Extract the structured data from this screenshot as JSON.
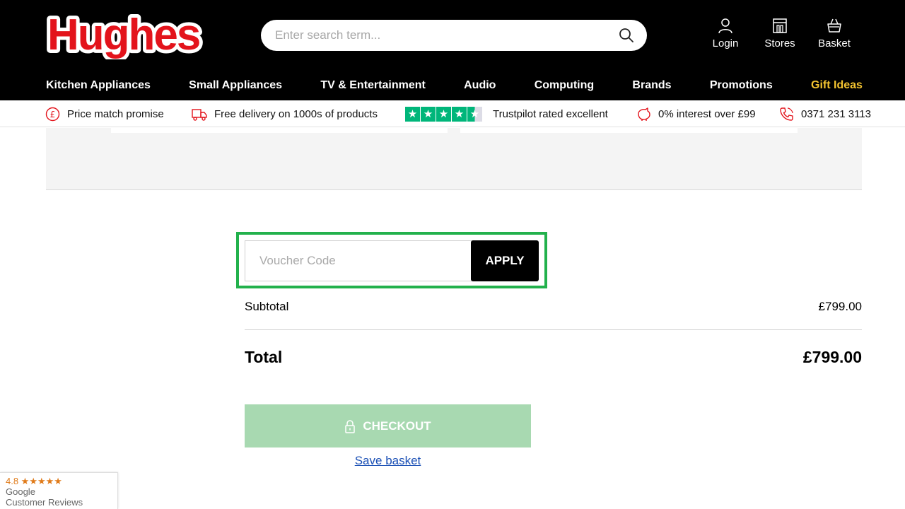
{
  "brand": {
    "name": "Hughes",
    "color": "#e3131b"
  },
  "search": {
    "placeholder": "Enter search term..."
  },
  "header_links": [
    {
      "label": "Login",
      "icon": "user-icon"
    },
    {
      "label": "Stores",
      "icon": "store-icon"
    },
    {
      "label": "Basket",
      "icon": "basket-icon"
    }
  ],
  "nav": [
    "Kitchen Appliances",
    "Small Appliances",
    "TV & Entertainment",
    "Audio",
    "Computing",
    "Brands",
    "Promotions",
    "Gift Ideas"
  ],
  "nav_highlight_color": "#f4c430",
  "usp": [
    {
      "text": "Price match promise",
      "icon": "pound-icon"
    },
    {
      "text": "Free delivery on 1000s of products",
      "icon": "delivery-truck-icon"
    },
    {
      "text": "Trustpilot rated excellent",
      "icon": "trustpilot-stars",
      "stars": 4.5
    },
    {
      "text": "0% interest over £99",
      "icon": "piggy-bank-icon"
    },
    {
      "text": "0371 231 3113",
      "icon": "phone-icon"
    }
  ],
  "voucher": {
    "placeholder": "Voucher Code",
    "button": "APPLY",
    "highlight_color": "#22b14c"
  },
  "summary": {
    "subtotal_label": "Subtotal",
    "subtotal_value": "£799.00",
    "total_label": "Total",
    "total_value": "£799.00"
  },
  "checkout": {
    "label": "CHECKOUT",
    "icon": "lock-icon",
    "color": "#a8d9b1"
  },
  "save_basket": "Save basket",
  "google_badge": {
    "rating": "4.8 ★★★★★",
    "line1": "Google",
    "line2": "Customer Reviews"
  }
}
